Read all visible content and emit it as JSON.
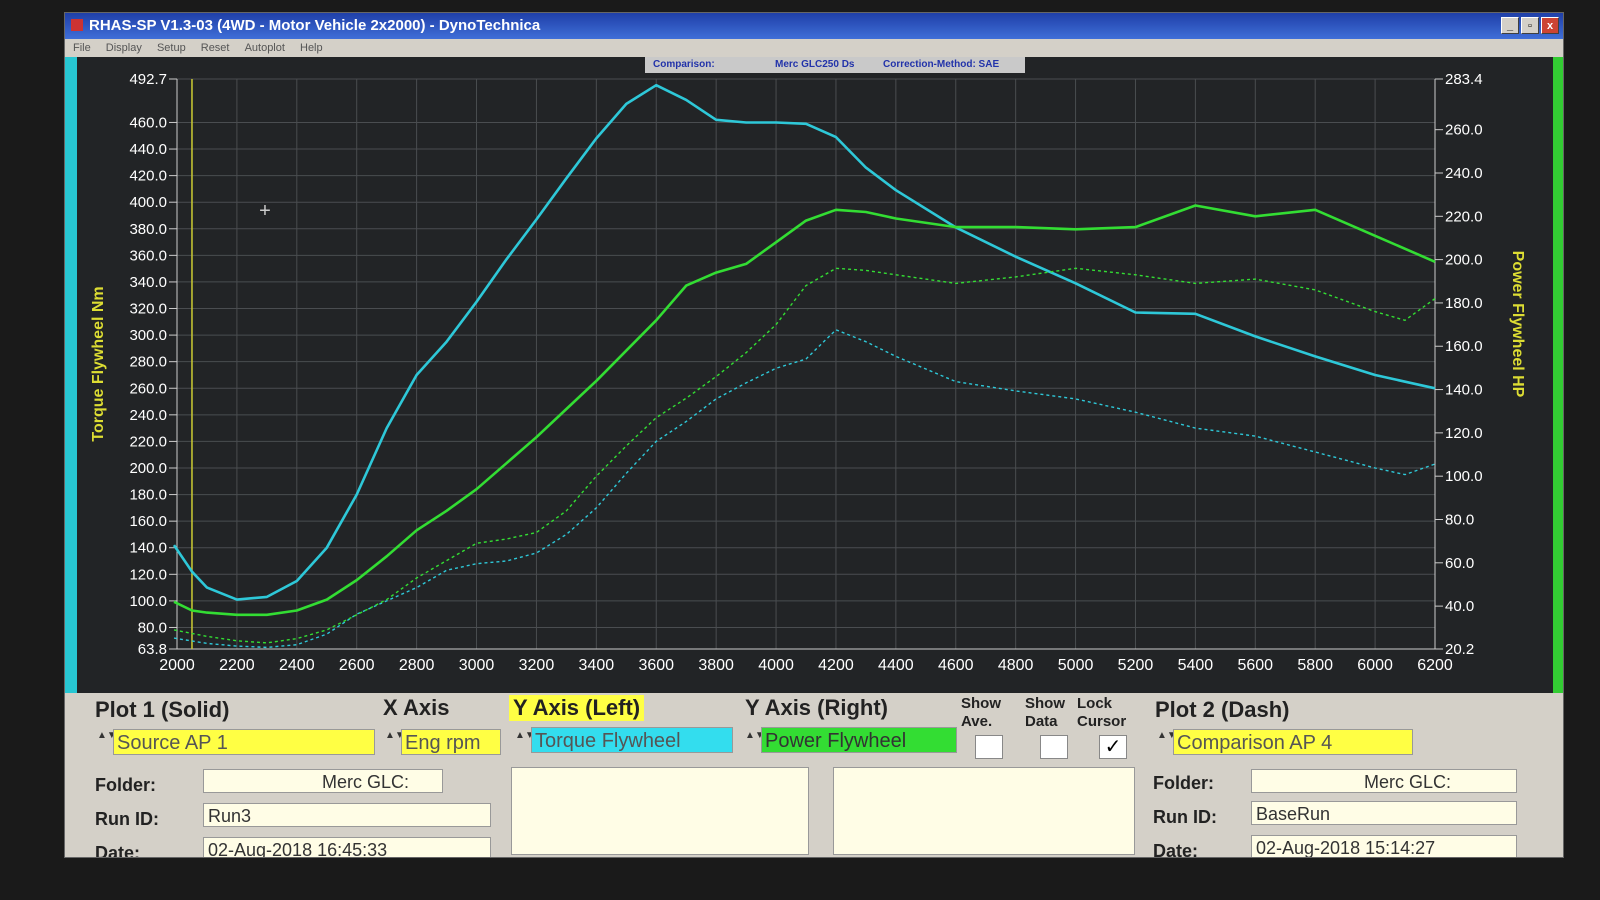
{
  "window": {
    "title": "RHAS-SP V1.3-03  (4WD - Motor Vehicle 2x2000) - DynoTechnica",
    "menu": [
      "File",
      "Display",
      "Setup",
      "Reset",
      "Autoplot",
      "Help"
    ],
    "buttons": {
      "minimize": "_",
      "maximize": "▫",
      "close": "x"
    }
  },
  "infobar": {
    "comparison_label": "Comparison:",
    "comparison_value": "Merc GLC250 Ds",
    "correction": "Correction-Method: SAE"
  },
  "chart_data": {
    "type": "line",
    "ylabel_left": "Torque Flywheel Nm",
    "ylabel_right": "Power Flywheel HP",
    "xlim": [
      2000,
      6200
    ],
    "ylim_left": [
      63.8,
      492.7
    ],
    "ylim_right": [
      20.2,
      283.4
    ],
    "x_ticks": [
      "2000",
      "2200",
      "2400",
      "2600",
      "2800",
      "3000",
      "3200",
      "3400",
      "3600",
      "3800",
      "4000",
      "4200",
      "4400",
      "4600",
      "4800",
      "5000",
      "5200",
      "5400",
      "5600",
      "5800",
      "6000",
      "6200"
    ],
    "y_left_ticks": [
      "63.8",
      "80.0",
      "100.0",
      "120.0",
      "140.0",
      "160.0",
      "180.0",
      "200.0",
      "220.0",
      "240.0",
      "260.0",
      "280.0",
      "300.0",
      "320.0",
      "340.0",
      "360.0",
      "380.0",
      "400.0",
      "420.0",
      "440.0",
      "460.0",
      "492.7"
    ],
    "y_right_ticks": [
      "20.2",
      "40.0",
      "60.0",
      "80.0",
      "100.0",
      "120.0",
      "140.0",
      "160.0",
      "180.0",
      "200.0",
      "220.0",
      "240.0",
      "260.0",
      "283.4"
    ],
    "grid": true,
    "cursor_rpm": 2050,
    "colors": {
      "torque": "#2ec8d8",
      "power": "#33dd33",
      "cursor": "#cccc33",
      "grid": "#4a4d50",
      "text": "#ffffff"
    },
    "series": [
      {
        "name": "Torque Flywheel",
        "color": "#2ec8d8",
        "dash": false,
        "axis": "left",
        "x": [
          1990,
          2050,
          2100,
          2200,
          2300,
          2400,
          2500,
          2600,
          2700,
          2800,
          2900,
          3000,
          3100,
          3200,
          3300,
          3400,
          3500,
          3600,
          3700,
          3800,
          3900,
          4000,
          4100,
          4200,
          4300,
          4400,
          4600,
          4800,
          5000,
          5200,
          5400,
          5600,
          5800,
          6000,
          6200
        ],
        "y": [
          142,
          122,
          110,
          101,
          103,
          115,
          140,
          180,
          230,
          270,
          295,
          325,
          357,
          387,
          418,
          448,
          474,
          488,
          477,
          462,
          460,
          460,
          459,
          449,
          426,
          409,
          381,
          359,
          339,
          317,
          316,
          299,
          284,
          270,
          260
        ]
      },
      {
        "name": "Power Flywheel",
        "color": "#33dd33",
        "dash": false,
        "axis": "right",
        "x": [
          1990,
          2050,
          2100,
          2200,
          2300,
          2400,
          2500,
          2600,
          2700,
          2800,
          2900,
          3000,
          3100,
          3200,
          3300,
          3400,
          3500,
          3600,
          3700,
          3800,
          3900,
          4000,
          4100,
          4200,
          4300,
          4400,
          4600,
          4800,
          5000,
          5200,
          5400,
          5600,
          5800,
          6000,
          6200
        ],
        "y": [
          42,
          38,
          37,
          36,
          36,
          38,
          43,
          52,
          63,
          75,
          84,
          94,
          106,
          118,
          131,
          144,
          158,
          172,
          188,
          194,
          198,
          208,
          218,
          223,
          222,
          219,
          215,
          215,
          214,
          215,
          225,
          220,
          223,
          211,
          199
        ]
      },
      {
        "name": "Torque Flywheel (Comparison)",
        "color": "#2ec8d8",
        "dash": true,
        "axis": "left",
        "x": [
          1990,
          2100,
          2200,
          2300,
          2400,
          2500,
          2600,
          2700,
          2800,
          2900,
          3000,
          3100,
          3200,
          3300,
          3400,
          3500,
          3600,
          3700,
          3800,
          3900,
          4000,
          4100,
          4200,
          4300,
          4400,
          4600,
          4800,
          5000,
          5200,
          5400,
          5600,
          5800,
          6000,
          6100,
          6200
        ],
        "y": [
          72,
          68,
          66,
          65,
          67,
          75,
          90,
          100,
          110,
          123,
          128,
          130,
          136,
          150,
          170,
          196,
          220,
          235,
          252,
          264,
          275,
          282,
          304,
          295,
          284,
          265,
          258,
          252,
          242,
          230,
          224,
          212,
          200,
          195,
          203
        ]
      },
      {
        "name": "Power Flywheel (Comparison)",
        "color": "#33dd33",
        "dash": true,
        "axis": "right",
        "x": [
          1990,
          2100,
          2200,
          2300,
          2400,
          2500,
          2600,
          2700,
          2800,
          2900,
          3000,
          3100,
          3200,
          3300,
          3400,
          3500,
          3600,
          3700,
          3800,
          3900,
          4000,
          4100,
          4200,
          4300,
          4400,
          4600,
          4800,
          5000,
          5200,
          5400,
          5600,
          5800,
          6000,
          6100,
          6200
        ],
        "y": [
          29,
          26,
          24,
          23,
          25,
          29,
          36,
          43,
          53,
          61,
          69,
          71,
          74,
          84,
          100,
          114,
          127,
          136,
          146,
          157,
          170,
          188,
          196,
          195,
          193,
          189,
          192,
          196,
          193,
          189,
          191,
          186,
          176,
          172,
          182
        ]
      }
    ]
  },
  "controls": {
    "plot1_header": "Plot 1 (Solid)",
    "xaxis_header": "X Axis",
    "yleft_header": "Y Axis (Left)",
    "yright_header": "Y Axis (Right)",
    "show_ave_header": "Show Ave.",
    "show_data_header": "Show Data",
    "lock_cursor_header": "Lock Cursor",
    "plot2_header": "Plot 2 (Dash)",
    "plot1_source": "Source AP 1",
    "xaxis_value": "Eng rpm",
    "yleft_value": "Torque Flywheel",
    "yright_value": "Power Flywheel",
    "plot2_source": "Comparison AP 4",
    "show_ave_checked": false,
    "show_data_checked": false,
    "lock_cursor_checked": true,
    "check_mark": "✓",
    "spin": "▲▼",
    "folder_label": "Folder:",
    "runid_label": "Run ID:",
    "date_label": "Date:",
    "plot1_folder": "Merc GLC:",
    "plot1_runid": "Run3",
    "plot1_date": "02-Aug-2018  16:45:33",
    "plot2_folder": "Merc GLC:",
    "plot2_runid": "BaseRun",
    "plot2_date": "02-Aug-2018  15:14:27",
    "field_colors": {
      "yellow": "#ffff44",
      "cyan": "#33ddee",
      "green": "#33dd33"
    }
  }
}
